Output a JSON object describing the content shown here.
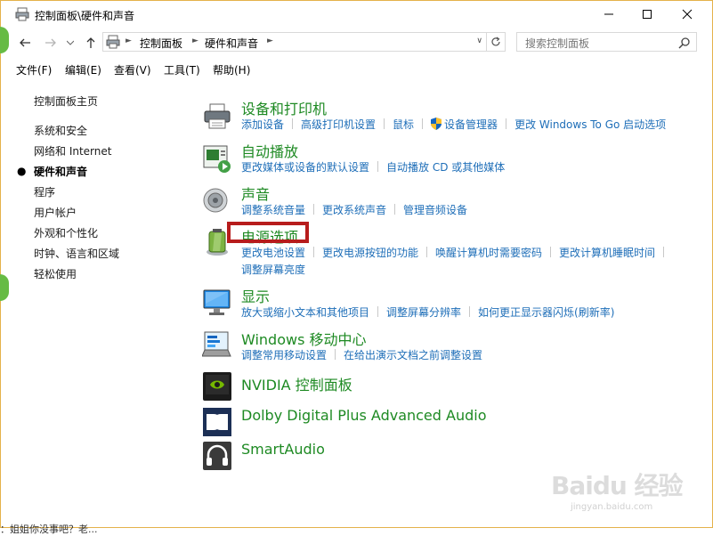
{
  "window": {
    "title": "控制面板\\硬件和声音"
  },
  "address": {
    "crumbs": [
      "控制面板",
      "硬件和声音"
    ],
    "search_placeholder": "搜索控制面板"
  },
  "menu": [
    "文件(F)",
    "编辑(E)",
    "查看(V)",
    "工具(T)",
    "帮助(H)"
  ],
  "sidebar": {
    "home": "控制面板主页",
    "items": [
      "系统和安全",
      "网络和 Internet",
      "硬件和声音",
      "程序",
      "用户帐户",
      "外观和个性化",
      "时钟、语言和区域",
      "轻松使用"
    ]
  },
  "categories": {
    "devices": {
      "title": "设备和打印机",
      "links": [
        "添加设备",
        "高级打印机设置",
        "鼠标",
        "设备管理器",
        "更改 Windows To Go 启动选项"
      ]
    },
    "autoplay": {
      "title": "自动播放",
      "links": [
        "更改媒体或设备的默认设置",
        "自动播放 CD 或其他媒体"
      ]
    },
    "sound": {
      "title": "声音",
      "links": [
        "调整系统音量",
        "更改系统声音",
        "管理音频设备"
      ]
    },
    "power": {
      "title": "电源选项",
      "links": [
        "更改电池设置",
        "更改电源按钮的功能",
        "唤醒计算机时需要密码",
        "更改计算机睡眠时间",
        "调整屏幕亮度"
      ]
    },
    "display": {
      "title": "显示",
      "links": [
        "放大或缩小文本和其他项目",
        "调整屏幕分辨率",
        "如何更正显示器闪烁(刷新率)"
      ]
    },
    "mobility": {
      "title": "Windows 移动中心",
      "links": [
        "调整常用移动设置",
        "在给出演示文档之前调整设置"
      ]
    },
    "nvidia": {
      "title": "NVIDIA 控制面板"
    },
    "dolby": {
      "title": "Dolby Digital Plus Advanced Audio"
    },
    "smartaudio": {
      "title": "SmartAudio"
    }
  },
  "watermark": {
    "main": "Baidu 经验",
    "sub": "jingyan.baidu.com"
  },
  "bottom_text": "：姐姐你没事吧？老...",
  "colors": {
    "category_title": "#1e8a23",
    "link": "#1e6eb8",
    "highlight": "#b71c1c",
    "window_border": "#e4b24a"
  }
}
